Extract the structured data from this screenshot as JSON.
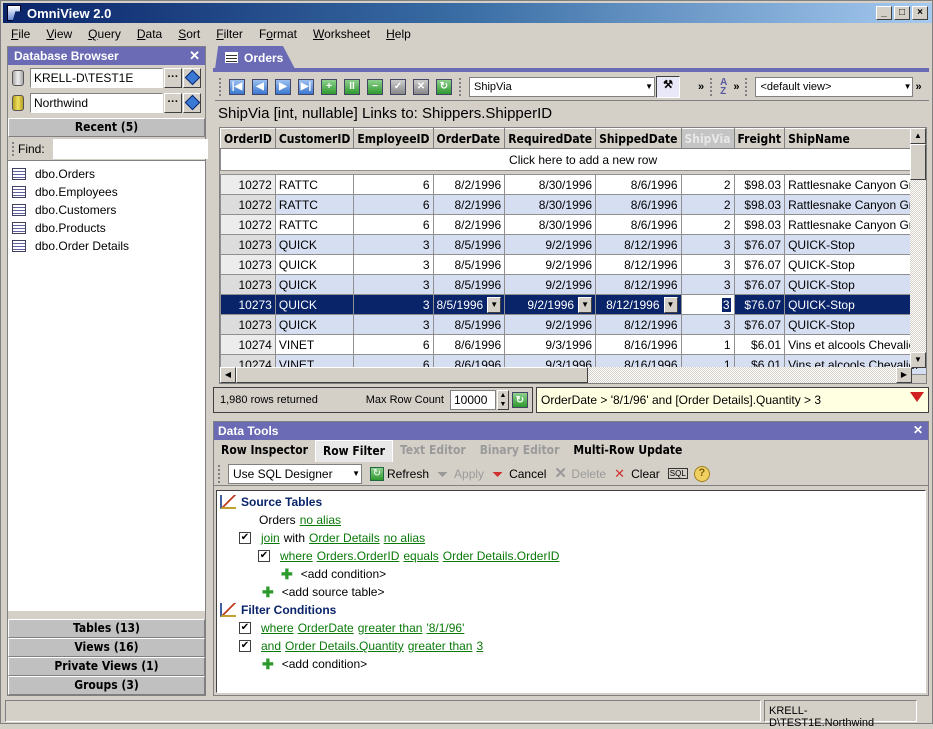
{
  "window": {
    "title": "OmniView 2.0",
    "controls": [
      "minimize",
      "maximize",
      "close"
    ]
  },
  "menu": [
    {
      "label": "File",
      "u": "F",
      "rest": "ile"
    },
    {
      "label": "View",
      "u": "V",
      "rest": "iew"
    },
    {
      "label": "Query",
      "u": "Q",
      "rest": "uery"
    },
    {
      "label": "Data",
      "u": "D",
      "rest": "ata"
    },
    {
      "label": "Sort",
      "u": "S",
      "rest": "ort"
    },
    {
      "label": "Filter",
      "u": "F",
      "rest": "ilter"
    },
    {
      "label": "Format",
      "u": "o",
      "pre": "F",
      "rest": "rmat"
    },
    {
      "label": "Worksheet",
      "u": "W",
      "rest": "orksheet"
    },
    {
      "label": "Help",
      "u": "H",
      "rest": "elp"
    }
  ],
  "browser": {
    "title": "Database Browser",
    "server": "KRELL-D\\TEST1E",
    "database": "Northwind",
    "browse_btn": "···",
    "recent_header": "Recent (5)",
    "find_label": "Find:",
    "find_value": "",
    "recent": [
      "dbo.Orders",
      "dbo.Employees",
      "dbo.Customers",
      "dbo.Products",
      "dbo.Order Details"
    ],
    "sections": [
      "Tables (13)",
      "Views (16)",
      "Private Views (1)",
      "Groups (3)"
    ]
  },
  "doc_tab": {
    "label": "Orders"
  },
  "toolbar": {
    "nav_buttons": [
      "first-record",
      "previous-record",
      "next-record",
      "last-record",
      "insert-record",
      "duplicate-record",
      "delete-record",
      "post-edit",
      "cancel-edit",
      "refresh"
    ],
    "column_select": "ShipVia",
    "view_select": "<default view>",
    "more": "»"
  },
  "column_info": "ShipVia [int, nullable]   Links to: Shippers.ShipperID",
  "grid": {
    "columns": [
      "OrderID",
      "CustomerID",
      "EmployeeID",
      "OrderDate",
      "RequiredDate",
      "ShippedDate",
      "ShipVia",
      "Freight",
      "ShipName"
    ],
    "active_column": "ShipVia",
    "new_row_text": "Click here to add a new row",
    "selected_row": 6,
    "rows": [
      [
        "10272",
        "RATTC",
        "6",
        "8/2/1996",
        "8/30/1996",
        "8/6/1996",
        "2",
        "$98.03",
        "Rattlesnake Canyon Grocery"
      ],
      [
        "10272",
        "RATTC",
        "6",
        "8/2/1996",
        "8/30/1996",
        "8/6/1996",
        "2",
        "$98.03",
        "Rattlesnake Canyon Grocery"
      ],
      [
        "10272",
        "RATTC",
        "6",
        "8/2/1996",
        "8/30/1996",
        "8/6/1996",
        "2",
        "$98.03",
        "Rattlesnake Canyon Grocery"
      ],
      [
        "10273",
        "QUICK",
        "3",
        "8/5/1996",
        "9/2/1996",
        "8/12/1996",
        "3",
        "$76.07",
        "QUICK-Stop"
      ],
      [
        "10273",
        "QUICK",
        "3",
        "8/5/1996",
        "9/2/1996",
        "8/12/1996",
        "3",
        "$76.07",
        "QUICK-Stop"
      ],
      [
        "10273",
        "QUICK",
        "3",
        "8/5/1996",
        "9/2/1996",
        "8/12/1996",
        "3",
        "$76.07",
        "QUICK-Stop"
      ],
      [
        "10273",
        "QUICK",
        "3",
        "8/5/1996",
        "9/2/1996",
        "8/12/1996",
        "3",
        "$76.07",
        "QUICK-Stop"
      ],
      [
        "10273",
        "QUICK",
        "3",
        "8/5/1996",
        "9/2/1996",
        "8/12/1996",
        "3",
        "$76.07",
        "QUICK-Stop"
      ],
      [
        "10274",
        "VINET",
        "6",
        "8/6/1996",
        "9/3/1996",
        "8/16/1996",
        "1",
        "$6.01",
        "Vins et alcools Chevalier"
      ],
      [
        "10274",
        "VINET",
        "6",
        "8/6/1996",
        "9/3/1996",
        "8/16/1996",
        "1",
        "$6.01",
        "Vins et alcools Chevalier"
      ]
    ]
  },
  "status": {
    "rows_returned": "1,980 rows returned",
    "max_row_label": "Max Row Count",
    "max_row_value": "10000",
    "filter_text": "OrderDate > '8/1/96' and [Order Details].Quantity > 3"
  },
  "data_tools": {
    "title": "Data Tools",
    "tabs": [
      {
        "label": "Row Inspector",
        "state": "normal"
      },
      {
        "label": "Row Filter",
        "state": "active"
      },
      {
        "label": "Text Editor",
        "state": "disabled"
      },
      {
        "label": "Binary Editor",
        "state": "disabled"
      },
      {
        "label": "Multi-Row Update",
        "state": "normal"
      }
    ],
    "mode_select": "Use SQL Designer",
    "actions": [
      {
        "label": "Refresh",
        "enabled": true,
        "icon": "refresh-icon"
      },
      {
        "label": "Apply",
        "enabled": false,
        "icon": "funnel-icon"
      },
      {
        "label": "Cancel",
        "enabled": true,
        "icon": "funnel-cancel-icon"
      },
      {
        "label": "Delete",
        "enabled": false,
        "icon": "delete-icon"
      },
      {
        "label": "Clear",
        "enabled": true,
        "icon": "clear-filter-icon"
      }
    ],
    "sql_label": "SQL",
    "source_tables_title": "Source Tables",
    "orders_label": "Orders",
    "no_alias": "no alias",
    "join": "join",
    "with": "with",
    "order_details": "Order Details",
    "where": "where",
    "orders_orderid": "Orders.OrderID",
    "equals": "equals",
    "od_orderid": "Order Details.OrderID",
    "add_condition": "<add condition>",
    "add_source_table": "<add source table>",
    "filter_conditions_title": "Filter Conditions",
    "c1_where": "where",
    "c1_field": "OrderDate",
    "c1_op": "greater than",
    "c1_value": "'8/1/96'",
    "c2_and": "and",
    "c2_field": "Order Details.Quantity",
    "c2_op": "greater than",
    "c2_value": "3"
  },
  "statusbar": {
    "connection": "KRELL-D\\TEST1E.Northwind"
  }
}
